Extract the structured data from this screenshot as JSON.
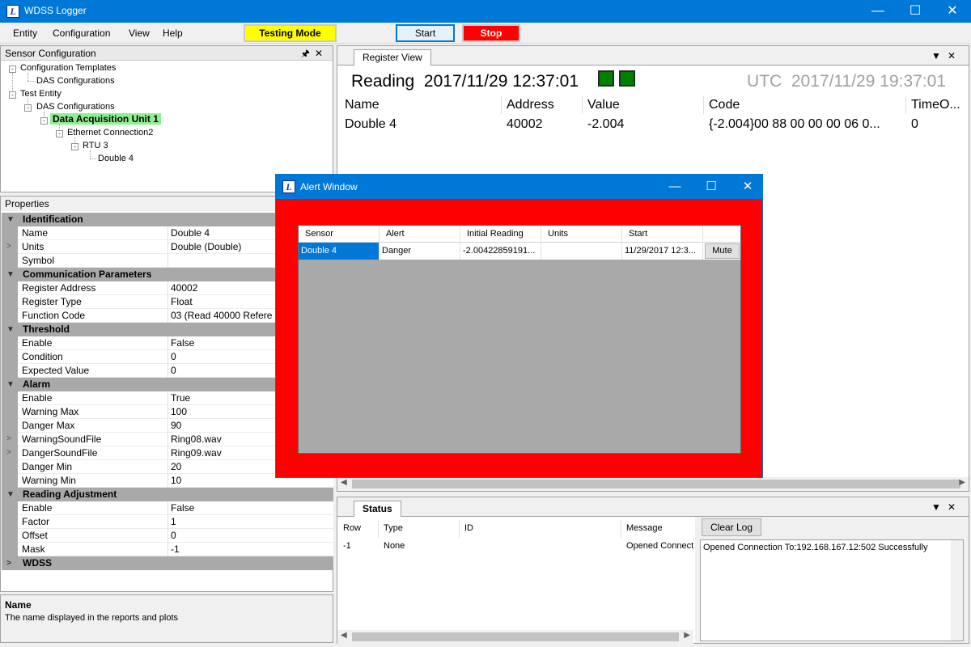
{
  "window": {
    "title": "WDSS Logger",
    "app_icon_letter": "L"
  },
  "menu": {
    "items": [
      "Entity",
      "Configuration",
      "View",
      "Help"
    ],
    "testing_mode_label": "Testing Mode",
    "start_label": "Start",
    "stop_label": "Stop"
  },
  "sensor_config": {
    "title": "Sensor Configuration",
    "tree": {
      "config_templates": "Configuration Templates",
      "das_configs_1": "DAS Configurations",
      "test_entity": "Test Entity",
      "das_configs_2": "DAS Configurations",
      "das_unit": "Data Acquisition Unit 1",
      "ethernet": "Ethernet Connection2",
      "rtu": "RTU 3",
      "double4": "Double 4"
    }
  },
  "properties": {
    "title": "Properties",
    "identification": {
      "label": "Identification",
      "name_label": "Name",
      "name_value": "Double 4",
      "units_label": "Units",
      "units_value": "Double (Double)",
      "symbol_label": "Symbol",
      "symbol_value": ""
    },
    "communication": {
      "label": "Communication Parameters",
      "register_address_label": "Register Address",
      "register_address_value": "40002",
      "register_type_label": "Register Type",
      "register_type_value": "Float",
      "function_code_label": "Function Code",
      "function_code_value": "03 (Read 40000 Refere"
    },
    "threshold": {
      "label": "Threshold",
      "enable_label": "Enable",
      "enable_value": "False",
      "condition_label": "Condition",
      "condition_value": "0",
      "expected_value_label": "Expected Value",
      "expected_value_value": "0"
    },
    "alarm": {
      "label": "Alarm",
      "enable_label": "Enable",
      "enable_value": "True",
      "warning_max_label": "Warning Max",
      "warning_max_value": "100",
      "danger_max_label": "Danger Max",
      "danger_max_value": "90",
      "warning_sound_label": "WarningSoundFile",
      "warning_sound_value": "Ring08.wav",
      "danger_sound_label": "DangerSoundFile",
      "danger_sound_value": "Ring09.wav",
      "danger_min_label": "Danger Min",
      "danger_min_value": "20",
      "warning_min_label": "Warning Min",
      "warning_min_value": "10"
    },
    "reading_adjustment": {
      "label": "Reading Adjustment",
      "enable_label": "Enable",
      "enable_value": "False",
      "factor_label": "Factor",
      "factor_value": "1",
      "offset_label": "Offset",
      "offset_value": "0",
      "mask_label": "Mask",
      "mask_value": "-1"
    },
    "wdss": {
      "label": "WDSS"
    }
  },
  "description": {
    "title": "Name",
    "text": "The name displayed in the reports and plots"
  },
  "register_view": {
    "tab_label": "Register View",
    "reading_label": "Reading",
    "reading_time": "2017/11/29 12:37:01",
    "utc_label": "UTC",
    "utc_time": "2017/11/29 19:37:01",
    "columns": [
      "Name",
      "Address",
      "Value",
      "Code",
      "TimeO..."
    ],
    "row": {
      "name": "Double 4",
      "address": "40002",
      "value": "-2.004",
      "code": "{-2.004}00  88  00  00  00  06  0...",
      "timeo": "0"
    }
  },
  "status": {
    "tab_label": "Status",
    "columns": [
      "Row",
      "Type",
      "ID",
      "Message"
    ],
    "row": {
      "row": "-1",
      "type": "None",
      "id": "",
      "message": "Opened Connect"
    },
    "clear_log_label": "Clear Log",
    "log_text": "Opened Connection To:192.168.167.12:502 Successfully"
  },
  "alert_window": {
    "title": "Alert Window",
    "columns": [
      "Sensor",
      "Alert",
      "Initial Reading",
      "Units",
      "Start"
    ],
    "row": {
      "sensor": "Double 4",
      "alert": "Danger",
      "initial_reading": "-2.00422859191...",
      "units": "",
      "start": "11/29/2017 12:3..."
    },
    "mute_label": "Mute",
    "background_color": "#ff0000"
  },
  "colors": {
    "titlebar": "#0078d7",
    "testing_mode": "#ffff00",
    "stop": "#ff0000",
    "selected_tree": "#8fef8f",
    "indicator": "#008000",
    "category_row": "#a9a9a9"
  }
}
